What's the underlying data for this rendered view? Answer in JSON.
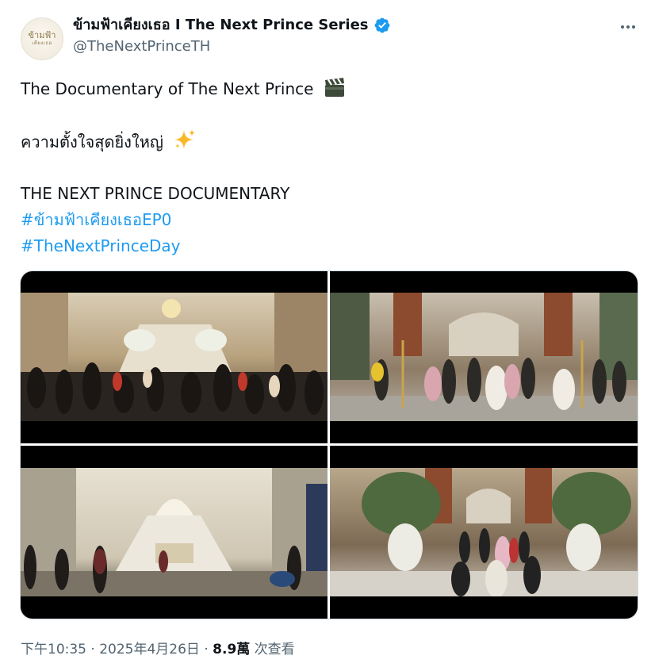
{
  "account": {
    "display_name": "ข้ามฟ้าเคียงเธอ I The Next Prince Series",
    "handle": "@TheNextPrinceTH",
    "verified_icon": "verified-badge-icon",
    "avatar_text_line1": "ข้ามฟ้า",
    "avatar_text_line2": "เคียงเธอ",
    "more_icon": "more-options-icon"
  },
  "tweet": {
    "line1": "The Documentary of The Next Prince",
    "line1_emoji": "clapper-board-icon",
    "line2": "ความตั้งใจสุดยิ่งใหญ่",
    "line2_emoji": "sparkles-icon",
    "line3": "THE NEXT PRINCE DOCUMENTARY",
    "hashtag1": "#ข้ามฟ้าเคียงเธอEP0",
    "hashtag2": "#TheNextPrinceDay"
  },
  "media": {
    "count": 4,
    "images": [
      "palace-staircase-crowd",
      "ballroom-dance-candelabras",
      "grand-hall-throne",
      "hall-procession-flowers"
    ]
  },
  "footer": {
    "time": "下午10:35",
    "date": "2025年4月26日",
    "views_count": "8.9萬",
    "views_label": "次查看"
  },
  "colors": {
    "link": "#1d9bf0",
    "verified": "#1d9bf0",
    "secondary_text": "#536471"
  }
}
